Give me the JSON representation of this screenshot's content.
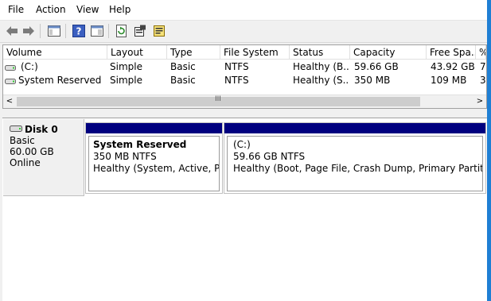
{
  "menu": {
    "file": "File",
    "action": "Action",
    "view": "View",
    "help": "Help"
  },
  "columns": [
    "Volume",
    "Layout",
    "Type",
    "File System",
    "Status",
    "Capacity",
    "Free Spa...",
    "%"
  ],
  "volumes": [
    {
      "volume": "(C:)",
      "layout": "Simple",
      "type": "Basic",
      "fs": "NTFS",
      "status": "Healthy (B...",
      "capacity": "59.66 GB",
      "free": "43.92 GB",
      "pct": "7"
    },
    {
      "volume": "System Reserved",
      "layout": "Simple",
      "type": "Basic",
      "fs": "NTFS",
      "status": "Healthy (S...",
      "capacity": "350 MB",
      "free": "109 MB",
      "pct": "3"
    }
  ],
  "scroll": {
    "grip": "III",
    "left": "<",
    "right": ">"
  },
  "disk": {
    "name": "Disk 0",
    "type": "Basic",
    "size": "60.00 GB",
    "state": "Online"
  },
  "partitions": [
    {
      "name": "System Reserved",
      "size": "350 MB NTFS",
      "status": "Healthy (System, Active, Prima"
    },
    {
      "name": "(C:)",
      "size": "59.66 GB NTFS",
      "status": "Healthy (Boot, Page File, Crash Dump, Primary Partition)"
    }
  ],
  "icons": [
    "back-arrow-icon",
    "forward-arrow-icon",
    "console-tree-icon",
    "help-icon",
    "show-hide-icon",
    "refresh-icon",
    "properties-icon",
    "export-icon",
    "drive-icon",
    "disk-icon"
  ]
}
